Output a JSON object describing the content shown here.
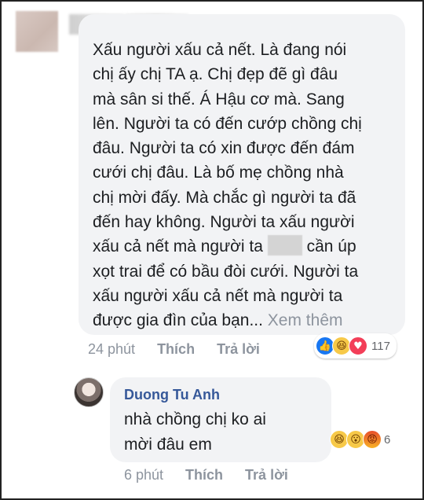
{
  "comment": {
    "text_before_censor": "Xấu người xấu cả nết. Là đang nói\nchị ấy chị TA ạ. Chị đẹp đẽ gì đâu\nmà sân si thế. Á Hậu cơ mà. Sang\nlên. Người ta có đến cướp chồng chị\nđâu. Người ta có xin được đến đám\ncưới chị đâu. Là bố mẹ chồng nhà\nchị mời đấy. Mà chắc gì người ta đã\nđến hay không. Người ta xấu người\nxấu cả nết mà người ta ",
    "text_after_censor": " cần úp\nxọt trai để có bầu đòi cưới. Người ta\nxấu người xấu cả nết mà người ta\nđược gia đìn của bạn... ",
    "see_more": "Xem thêm",
    "time": "24 phút",
    "like_label": "Thích",
    "reply_label": "Trả lời",
    "reactions": [
      "like",
      "haha",
      "love"
    ],
    "reaction_count": "117"
  },
  "reply": {
    "author": "Duong Tu Anh",
    "text": "nhà chồng chị ko ai\nmời đâu em",
    "time": "6 phút",
    "like_label": "Thích",
    "reply_label": "Trả lời",
    "reactions": [
      "haha",
      "wow",
      "angry"
    ],
    "reaction_count": "6"
  },
  "icons": {
    "like": "👍",
    "haha": "😆",
    "love": "♥",
    "wow": "😮",
    "angry": "😡"
  }
}
